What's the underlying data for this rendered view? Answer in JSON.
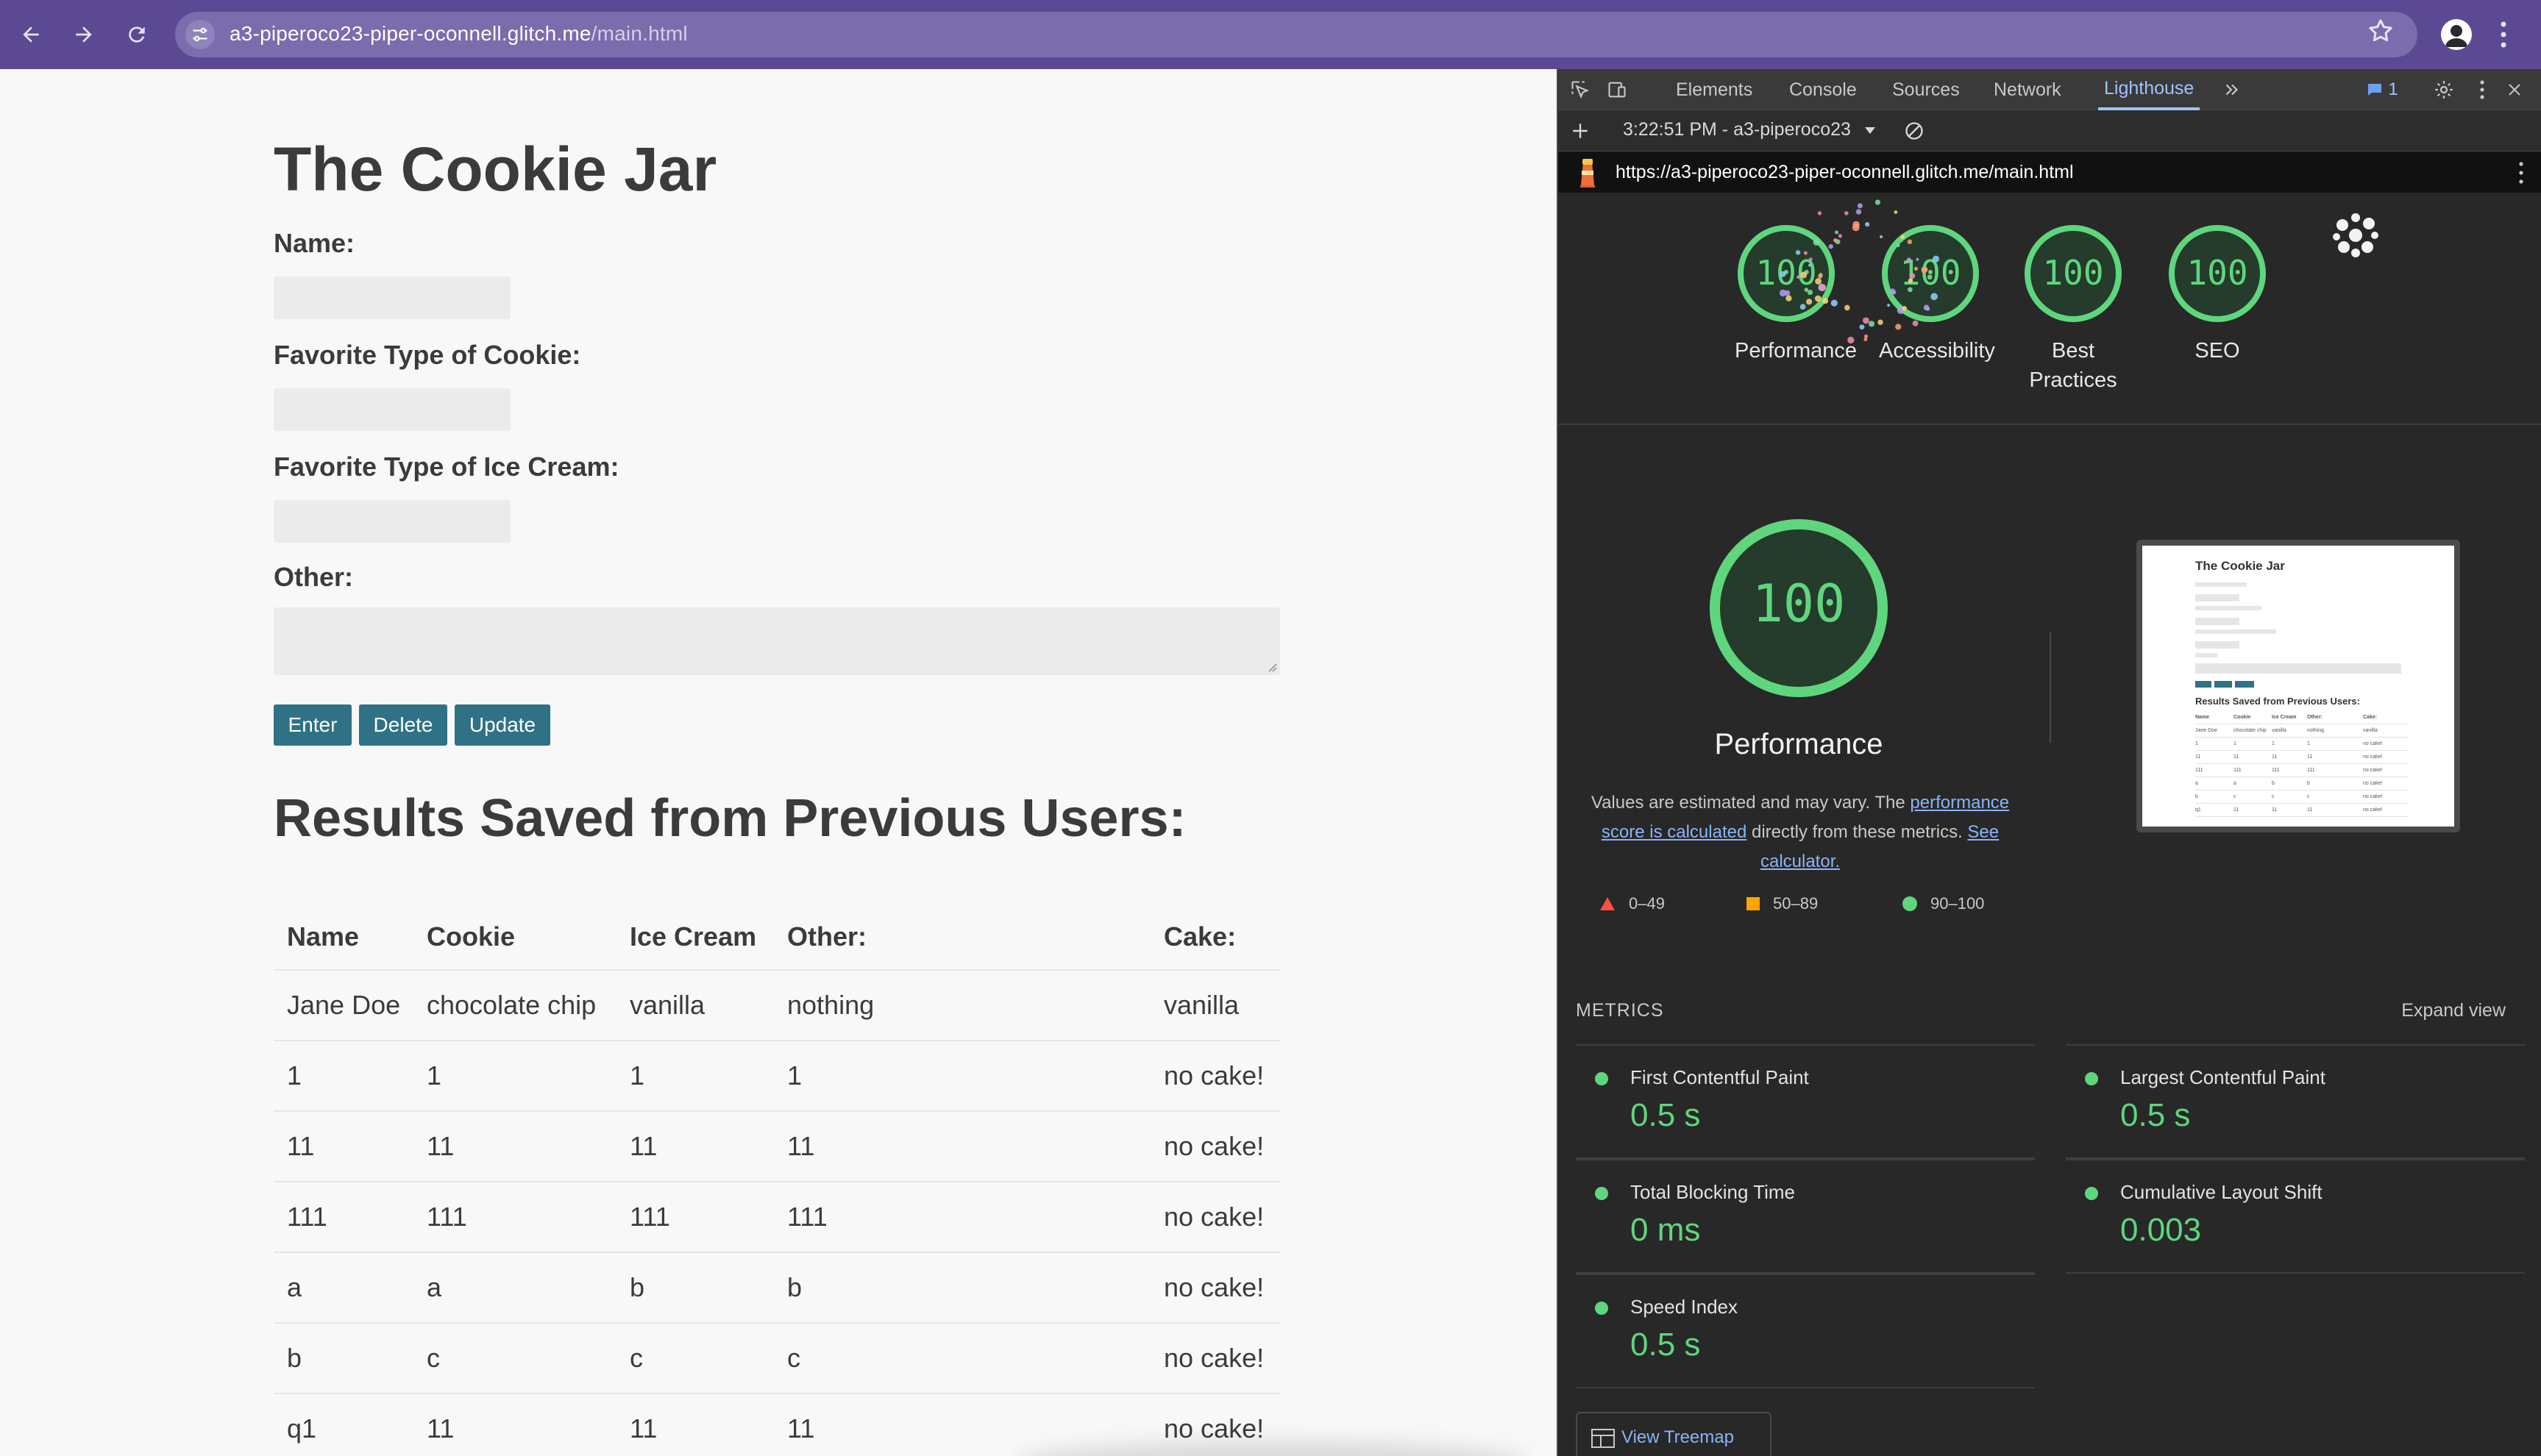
{
  "browser": {
    "url_host": "a3-piperoco23-piper-oconnell.glitch.me",
    "url_path": "/main.html"
  },
  "page": {
    "title": "The Cookie Jar",
    "form": {
      "name_label": "Name:",
      "cookie_label": "Favorite Type of Cookie:",
      "icecream_label": "Favorite Type of Ice Cream:",
      "other_label": "Other:",
      "name_value": "",
      "cookie_value": "",
      "icecream_value": "",
      "other_value": ""
    },
    "buttons": {
      "enter": "Enter",
      "delete": "Delete",
      "update": "Update"
    },
    "results_title": "Results Saved from Previous Users:",
    "table": {
      "headers": [
        "Name",
        "Cookie",
        "Ice Cream",
        "Other:",
        "Cake:"
      ],
      "rows": [
        [
          "Jane Doe",
          "chocolate chip",
          "vanilla",
          "nothing",
          "vanilla"
        ],
        [
          "1",
          "1",
          "1",
          "1",
          "no cake!"
        ],
        [
          "11",
          "11",
          "11",
          "11",
          "no cake!"
        ],
        [
          "111",
          "111",
          "111",
          "111",
          "no cake!"
        ],
        [
          "a",
          "a",
          "b",
          "b",
          "no cake!"
        ],
        [
          "b",
          "c",
          "c",
          "c",
          "no cake!"
        ],
        [
          "q1",
          "11",
          "11",
          "11",
          "no cake!"
        ]
      ]
    }
  },
  "devtools": {
    "tabs": [
      "Elements",
      "Console",
      "Sources",
      "Network",
      "Lighthouse"
    ],
    "active_tab": "Lighthouse",
    "issues_count": "1",
    "report_select": "3:22:51 PM - a3-piperoco23",
    "report_url": "https://a3-piperoco23-piper-oconnell.glitch.me/main.html",
    "categories": [
      {
        "score": "100",
        "label": "Performance"
      },
      {
        "score": "100",
        "label": "Accessibility"
      },
      {
        "score": "100",
        "label": "Best Practices"
      },
      {
        "score": "100",
        "label": "SEO"
      }
    ],
    "main_score": "100",
    "main_label": "Performance",
    "note_prefix": "Values are estimated and may vary. The ",
    "note_link1": "performance score is calculated",
    "note_middle": " directly from these metrics. ",
    "note_link2": "See calculator.",
    "legend": {
      "low": "0–49",
      "mid": "50–89",
      "high": "90–100"
    },
    "thumbnail": {
      "title": "The Cookie Jar",
      "results": "Results Saved from Previous Users:"
    },
    "metrics_title": "METRICS",
    "expand_view": "Expand view",
    "metrics": [
      {
        "label": "First Contentful Paint",
        "value": "0.5 s"
      },
      {
        "label": "Largest Contentful Paint",
        "value": "0.5 s"
      },
      {
        "label": "Total Blocking Time",
        "value": "0 ms"
      },
      {
        "label": "Cumulative Layout Shift",
        "value": "0.003"
      },
      {
        "label": "Speed Index",
        "value": "0.5 s"
      }
    ],
    "view_treemap": "View Treemap"
  },
  "colors": {
    "chrome": "#5b4a93",
    "button": "#2f7185",
    "good": "#5fd67d",
    "link": "#8ab4f8"
  }
}
